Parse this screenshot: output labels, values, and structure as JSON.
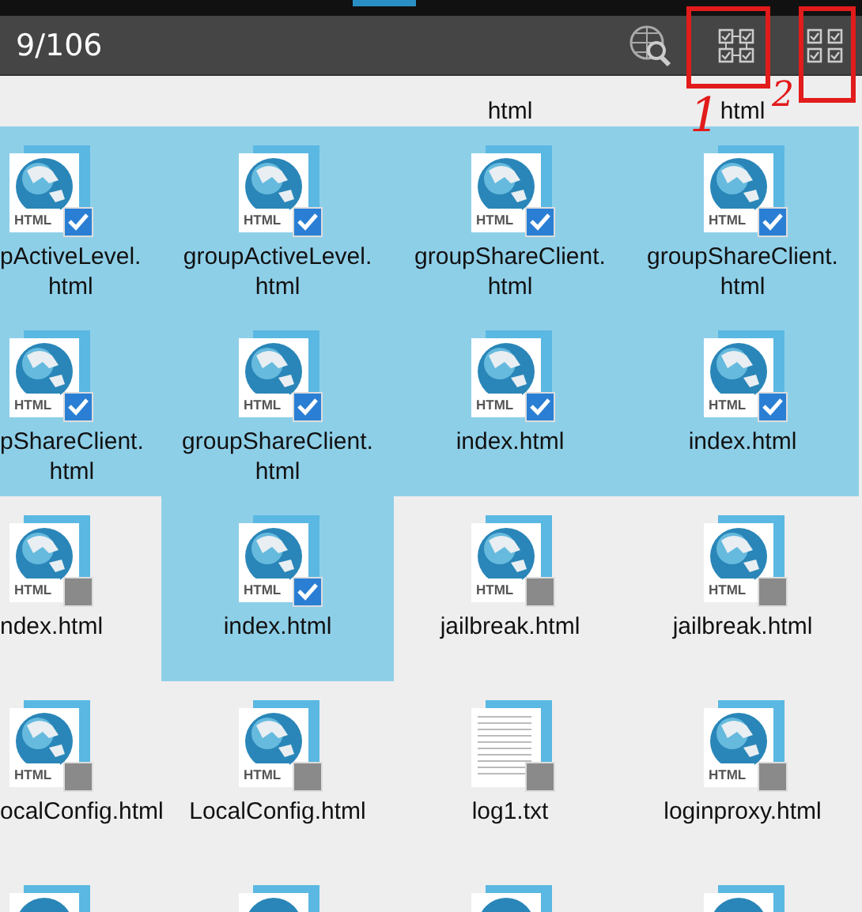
{
  "toolbar": {
    "count": "9/106"
  },
  "annotations": [
    {
      "label": "1"
    },
    {
      "label": "2"
    }
  ],
  "partial_row": [
    {
      "label": "html"
    },
    {
      "label": "html"
    }
  ],
  "rows": [
    [
      {
        "kind": "html",
        "badge": "HTML",
        "label": [
          "pActiveLevel.",
          "html"
        ],
        "selected": true
      },
      {
        "kind": "html",
        "badge": "HTML",
        "label": [
          "groupActiveLevel.",
          "html"
        ],
        "selected": true
      },
      {
        "kind": "html",
        "badge": "HTML",
        "label": [
          "groupShareClient.",
          "html"
        ],
        "selected": true
      },
      {
        "kind": "html",
        "badge": "HTML",
        "label": [
          "groupShareClient.",
          "html"
        ],
        "selected": true
      }
    ],
    [
      {
        "kind": "html",
        "badge": "HTML",
        "label": [
          "pShareClient.",
          "html"
        ],
        "selected": true
      },
      {
        "kind": "html",
        "badge": "HTML",
        "label": [
          "groupShareClient.",
          "html"
        ],
        "selected": true
      },
      {
        "kind": "html",
        "badge": "HTML",
        "label": [
          "index.html"
        ],
        "selected": true
      },
      {
        "kind": "html",
        "badge": "HTML",
        "label": [
          "index.html"
        ],
        "selected": true
      }
    ],
    [
      {
        "kind": "html",
        "badge": "HTML",
        "label": [
          "ndex.html"
        ],
        "selected": false
      },
      {
        "kind": "html",
        "badge": "HTML",
        "label": [
          "index.html"
        ],
        "selected": true
      },
      {
        "kind": "html",
        "badge": "HTML",
        "label": [
          "jailbreak.html"
        ],
        "selected": false
      },
      {
        "kind": "html",
        "badge": "HTML",
        "label": [
          "jailbreak.html"
        ],
        "selected": false
      }
    ],
    [
      {
        "kind": "html",
        "badge": "HTML",
        "label": [
          "ocalConfig.html"
        ],
        "selected": false
      },
      {
        "kind": "html",
        "badge": "HTML",
        "label": [
          "LocalConfig.html"
        ],
        "selected": false
      },
      {
        "kind": "txt",
        "label": [
          "log1.txt"
        ],
        "selected": false
      },
      {
        "kind": "html",
        "badge": "HTML",
        "label": [
          "loginproxy.html"
        ],
        "selected": false
      }
    ]
  ],
  "cut_row": [
    {
      "kind": "html"
    },
    {
      "kind": "html"
    },
    {
      "kind": "html"
    },
    {
      "kind": "html"
    }
  ]
}
